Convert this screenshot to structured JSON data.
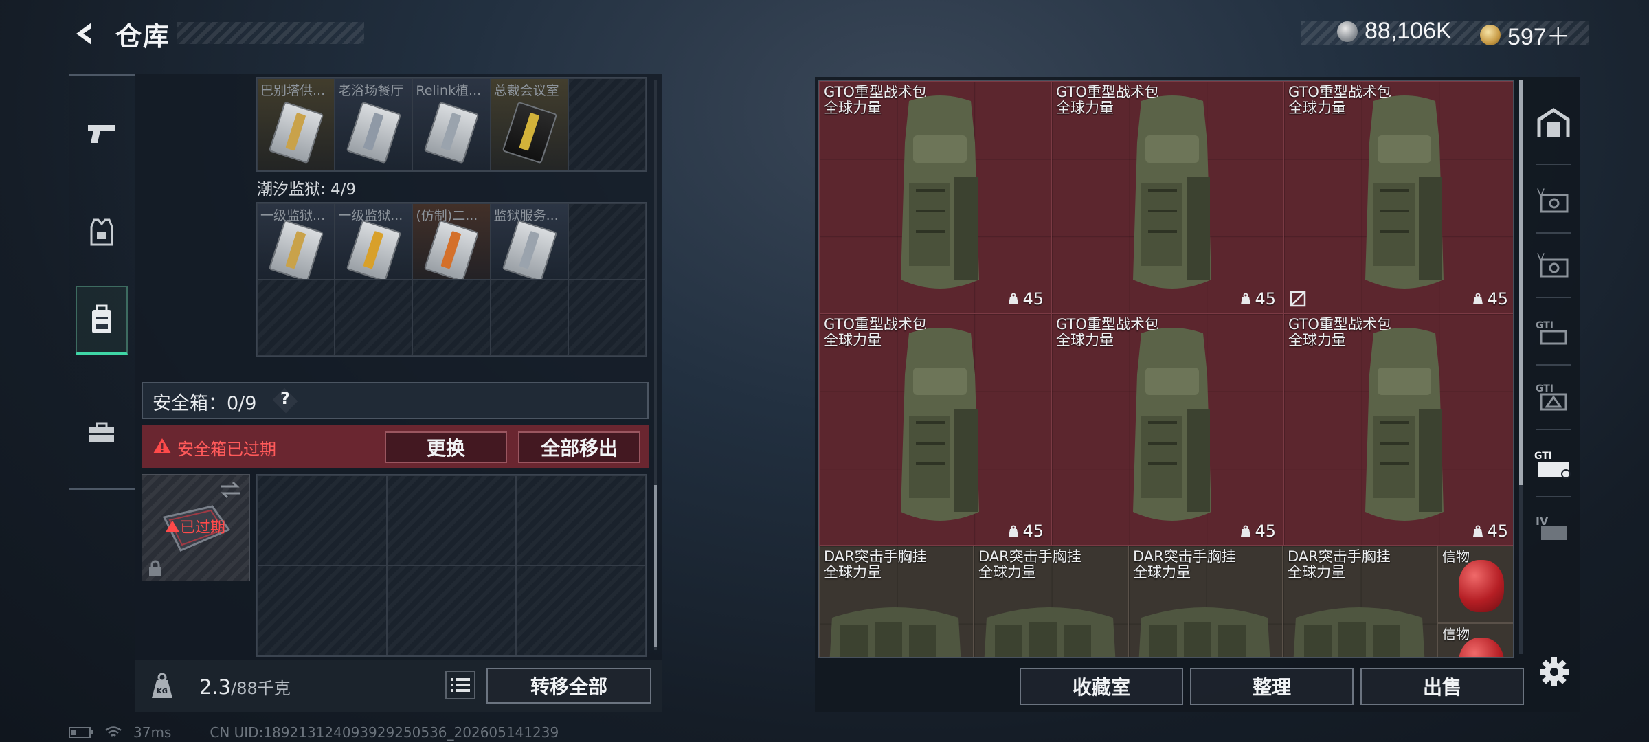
{
  "header": {
    "title": "仓库",
    "currency_a": "88,106K",
    "currency_b": "597＋"
  },
  "left_nav": {
    "items": [
      {
        "icon": "pistol-icon"
      },
      {
        "icon": "vest-icon"
      },
      {
        "icon": "backpack-icon",
        "active": true
      },
      {
        "icon": "toolbox-icon"
      }
    ]
  },
  "inventory": {
    "top_row": [
      "巴别塔供...",
      "老浴场餐厅",
      "Relink植...",
      "总裁会议室"
    ],
    "prison": {
      "label": "潮汐监狱: 4/9",
      "items": [
        "一级监狱...",
        "一级监狱...",
        "(仿制)二...",
        "监狱服务..."
      ]
    },
    "safe": {
      "title": "安全箱：0/9",
      "help": "?",
      "expired_text": "安全箱已过期",
      "replace_label": "更换",
      "move_all_label": "全部移出",
      "item_status": "已过期"
    },
    "weight": {
      "current": "2.3",
      "max": "/88千克",
      "icon_text": "KG"
    },
    "transfer_all_label": "转移全部"
  },
  "stash": {
    "backpacks": [
      {
        "name": "GTO重型战术包",
        "sub": "全球力量",
        "count": "45"
      },
      {
        "name": "GTO重型战术包",
        "sub": "全球力量",
        "count": "45"
      },
      {
        "name": "GTO重型战术包",
        "sub": "全球力量",
        "count": "45"
      },
      {
        "name": "GTO重型战术包",
        "sub": "全球力量",
        "count": "45"
      },
      {
        "name": "GTO重型战术包",
        "sub": "全球力量",
        "count": "45"
      },
      {
        "name": "GTO重型战术包",
        "sub": "全球力量",
        "count": "45"
      }
    ],
    "rigs": [
      {
        "name": "DAR突击手胸挂",
        "sub": "全球力量"
      },
      {
        "name": "DAR突击手胸挂",
        "sub": "全球力量"
      },
      {
        "name": "DAR突击手胸挂",
        "sub": "全球力量"
      },
      {
        "name": "DAR突击手胸挂",
        "sub": "全球力量"
      }
    ],
    "tokens": [
      {
        "name": "信物"
      },
      {
        "name": "信物"
      }
    ]
  },
  "bottom_buttons": {
    "collection": "收藏室",
    "organize": "整理",
    "sell": "出售"
  },
  "status_bar": {
    "ping": "37ms",
    "uid": "CN UID:18921312409392925053​6_202605141239"
  }
}
